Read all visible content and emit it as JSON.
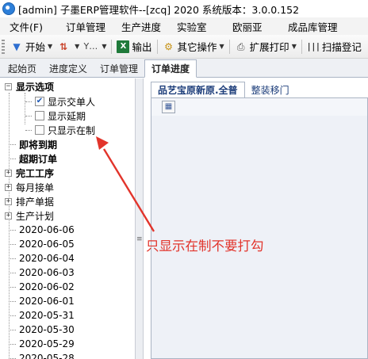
{
  "window": {
    "title": "[admin] 子墨ERP管理软件--[zcq] 2020 系统版本：3.0.0.152"
  },
  "menu": [
    "文件(F)",
    "订单管理",
    "生产进度",
    "实验室",
    "欧丽亚",
    "成品库管理"
  ],
  "toolbar": {
    "start": "开始",
    "export": "输出",
    "other_ops": "其它操作",
    "ext_print": "扩展打印",
    "scan_login": "扫描登记"
  },
  "tabs": [
    "起始页",
    "进度定义",
    "订单管理",
    "订单进度"
  ],
  "active_tab": "订单进度",
  "tree": {
    "display_options": "显示选项",
    "show_creator": "显示交单人",
    "show_delay": "显示延期",
    "show_in_production": "只显示在制",
    "due_soon": "即将到期",
    "overdue": "超期订单",
    "finished_process": "完工工序",
    "monthly_orders": "每月接单",
    "production_orders": "排产单据",
    "production_plan": "生产计划",
    "dates": [
      "2020-06-06",
      "2020-06-05",
      "2020-06-04",
      "2020-06-03",
      "2020-06-02",
      "2020-06-01",
      "2020-05-31",
      "2020-05-30",
      "2020-05-29",
      "2020-05-28"
    ]
  },
  "inner_tabs": [
    "品艺宝原新原.全普",
    "整装移门"
  ],
  "annotation": {
    "text": "只显示在制不要打勾",
    "color": "#e2342b"
  }
}
